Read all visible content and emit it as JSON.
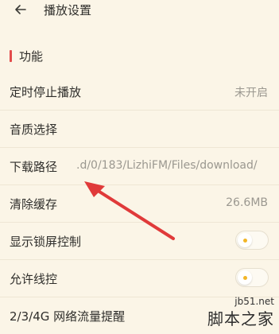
{
  "header": {
    "title": "播放设置"
  },
  "section": {
    "label": "功能",
    "accent_color": "#e34b4b"
  },
  "rows": [
    {
      "label": "定时停止播放",
      "value": "未开启"
    },
    {
      "label": "音质选择"
    },
    {
      "label": "下载路径",
      "value": ".d/0/183/LizhiFM/Files/download/"
    },
    {
      "label": "清除缓存",
      "value": "26.6MB"
    },
    {
      "label": "显示锁屏控制",
      "toggle": "off"
    },
    {
      "label": "允许线控",
      "toggle": "off"
    },
    {
      "label": "2/3/4G 网络流量提醒"
    }
  ],
  "watermark": {
    "url": "jb51.net",
    "text": "脚本之家"
  },
  "colors": {
    "background": "#fbf5e7",
    "arrow": "#e03a3a",
    "toggle_dot": "#f2b526"
  }
}
